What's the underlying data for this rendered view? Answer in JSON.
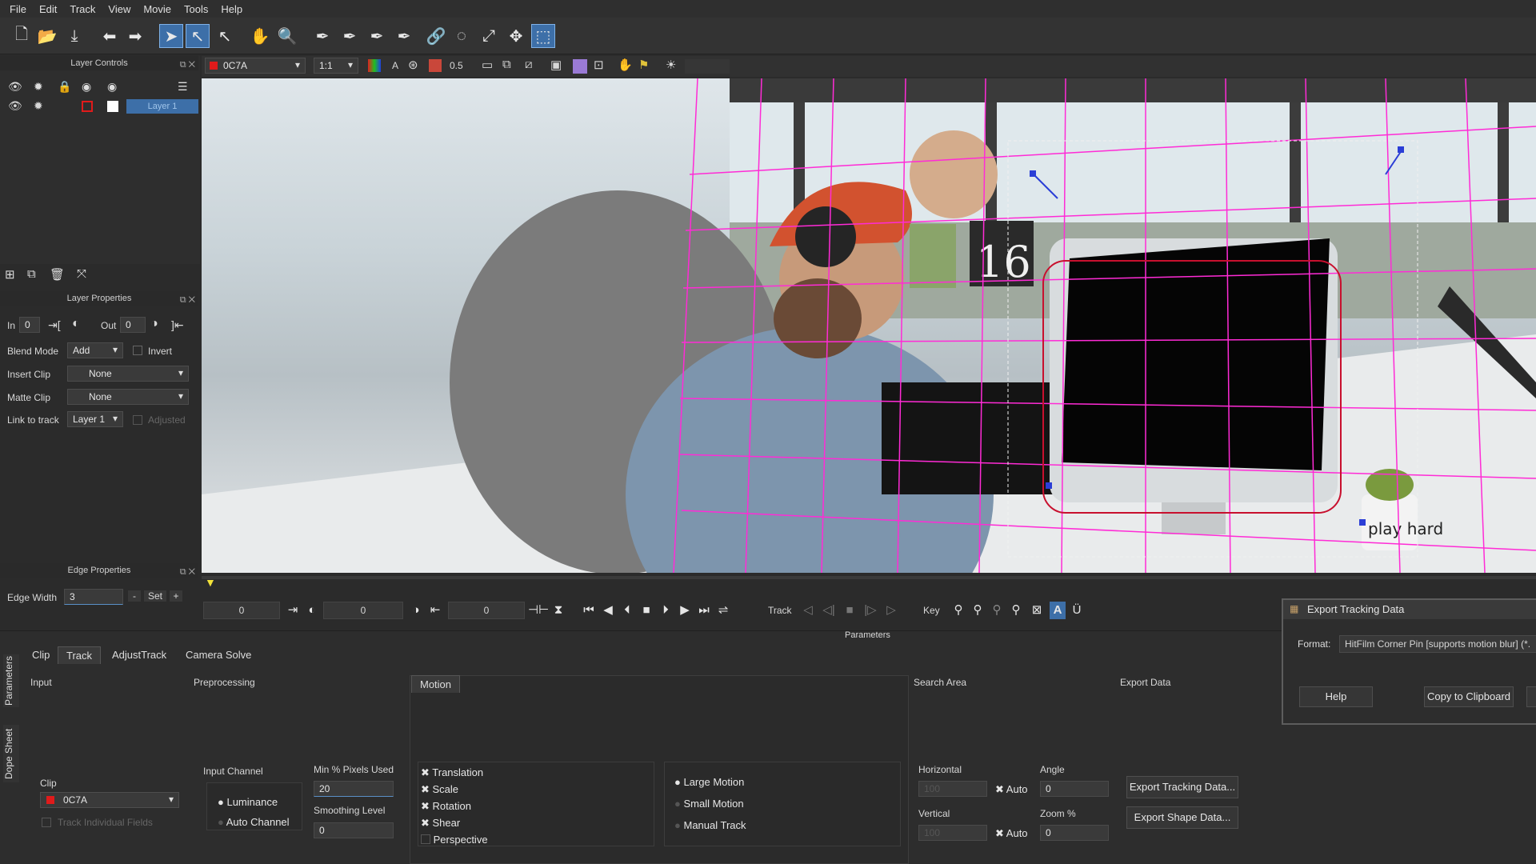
{
  "menu": [
    "File",
    "Edit",
    "Track",
    "View",
    "Movie",
    "Tools",
    "Help"
  ],
  "layer_controls": {
    "title": "Layer Controls",
    "layer_name": "Layer 1"
  },
  "layer_properties": {
    "title": "Layer Properties",
    "in_label": "In",
    "in_value": "0",
    "out_label": "Out",
    "out_value": "0",
    "blend_mode_label": "Blend Mode",
    "blend_mode_value": "Add",
    "invert_label": "Invert",
    "insert_clip_label": "Insert Clip",
    "insert_clip_value": "None",
    "matte_clip_label": "Matte Clip",
    "matte_clip_value": "None",
    "link_to_track_label": "Link to track",
    "link_to_track_value": "Layer 1",
    "adjusted_label": "Adjusted"
  },
  "edge_properties": {
    "title": "Edge Properties",
    "edge_width_label": "Edge Width",
    "edge_width_value": "3",
    "minus": "-",
    "set": "Set",
    "plus": "+"
  },
  "viewer_bar": {
    "clip": "0C7A",
    "zoom": "1:1",
    "opacity": "0.5",
    "ratio_label": "A"
  },
  "viewer": {
    "mug_text": "play hard",
    "calendar_text": "16"
  },
  "timeline": {
    "field1": "0",
    "field2": "0",
    "field3": "0",
    "track_label": "Track",
    "key_label": "Key"
  },
  "parameters": {
    "title": "Parameters",
    "side_tabs": [
      "Parameters",
      "Dope Sheet"
    ],
    "tabs": [
      "Clip",
      "Track",
      "AdjustTrack",
      "Camera Solve"
    ],
    "input": {
      "title": "Input",
      "clip_label": "Clip",
      "clip_value": "0C7A",
      "track_fields_label": "Track Individual Fields"
    },
    "preprocessing": {
      "title": "Preprocessing",
      "input_channel_label": "Input Channel",
      "luminance": "Luminance",
      "auto_channel": "Auto Channel",
      "min_pixels_label": "Min % Pixels Used",
      "min_pixels_value": "20",
      "smoothing_label": "Smoothing Level",
      "smoothing_value": "0"
    },
    "motion": {
      "title": "Motion",
      "translation": "Translation",
      "scale": "Scale",
      "rotation": "Rotation",
      "shear": "Shear",
      "perspective": "Perspective",
      "large_motion": "Large Motion",
      "small_motion": "Small Motion",
      "manual_track": "Manual Track"
    },
    "search_area": {
      "title": "Search Area",
      "horizontal_label": "Horizontal",
      "horizontal_value": "100",
      "vertical_label": "Vertical",
      "vertical_value": "100",
      "auto_label": "Auto",
      "angle_label": "Angle",
      "angle_value": "0",
      "zoom_label": "Zoom %",
      "zoom_value": "0"
    },
    "export_data": {
      "title": "Export Data",
      "export_tracking": "Export Tracking Data...",
      "export_shape": "Export Shape Data..."
    }
  },
  "dialog": {
    "title": "Export Tracking Data",
    "format_label": "Format:",
    "format_value": "HitFilm Corner Pin [supports motion blur] (*.",
    "help": "Help",
    "copy": "Copy to Clipboard"
  },
  "colors": {
    "accent": "#3d6fa8",
    "grid": "#ff2bd6",
    "clip_red": "#e01b1b"
  }
}
